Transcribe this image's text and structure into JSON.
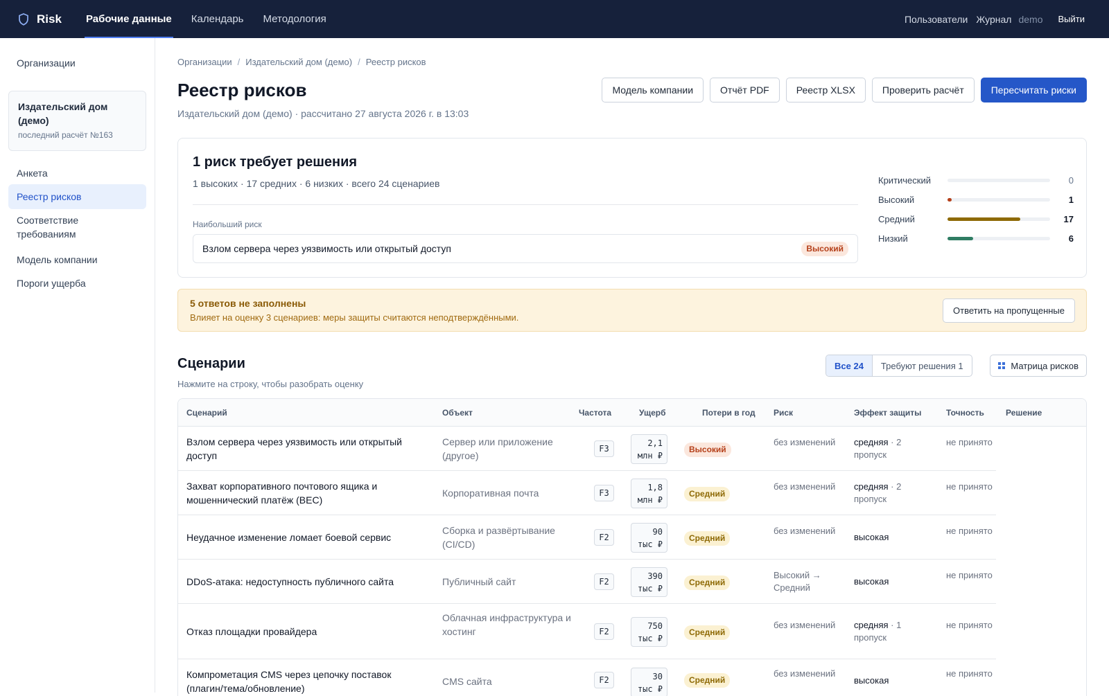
{
  "app": {
    "name": "Risk"
  },
  "nav": [
    {
      "label": "Рабочие данные",
      "active": true
    },
    {
      "label": "Календарь",
      "active": false
    },
    {
      "label": "Методология",
      "active": false
    }
  ],
  "topbar": {
    "users": "Пользователи",
    "journal": "Журнал",
    "user": "demo",
    "logout": "Выйти"
  },
  "sidebar": {
    "orgs_link": "Организации",
    "org_card": {
      "name": "Издательский дом (демо)",
      "sub": "последний расчёт №163"
    },
    "items": [
      {
        "label": "Анкета",
        "active": false
      },
      {
        "label": "Реестр рисков",
        "active": true
      },
      {
        "label": "Соответствие требованиям",
        "active": false
      },
      {
        "label": "Модель компании",
        "active": false
      },
      {
        "label": "Пороги ущерба",
        "active": false
      }
    ]
  },
  "breadcrumb": [
    "Организации",
    "Издательский дом (демо)",
    "Реестр рисков"
  ],
  "page": {
    "title": "Реестр рисков",
    "subtitle": "Издательский дом (демо) · рассчитано 27 августа 2026 г. в 13:03"
  },
  "actions": {
    "model": "Модель компании",
    "pdf": "Отчёт PDF",
    "xlsx": "Реестр XLSX",
    "check": "Проверить расчёт",
    "recalc": "Пересчитать риски"
  },
  "summary": {
    "title": "1 риск требует решения",
    "subtitle": "1 высоких · 17 средних · 6 низких · всего 24 сценариев",
    "top_label": "Наибольший риск",
    "top_risk": "Взлом сервера через уязвимость или открытый доступ",
    "top_level": "Высокий",
    "distribution": [
      {
        "label": "Критический",
        "count": 0,
        "fraction": 0.0,
        "color": "#b5401a"
      },
      {
        "label": "Высокий",
        "count": 1,
        "fraction": 0.04,
        "color": "#b5401a"
      },
      {
        "label": "Средний",
        "count": 17,
        "fraction": 0.71,
        "color": "#8e6a06"
      },
      {
        "label": "Низкий",
        "count": 6,
        "fraction": 0.25,
        "color": "#2f7d63"
      }
    ]
  },
  "alert": {
    "title": "5 ответов не заполнены",
    "text": "Влияет на оценку 3 сценариев: меры защиты считаются неподтверждёнными.",
    "button": "Ответить на пропущенные"
  },
  "scenarios": {
    "title": "Сценарии",
    "subtitle": "Нажмите на строку, чтобы разобрать оценку",
    "filter_all": "Все 24",
    "filter_pending": "Требуют решения 1",
    "matrix_button": "Матрица рисков",
    "columns": {
      "scenario": "Сценарий",
      "object": "Объект",
      "freq": "Частота",
      "damage": "Ущерб",
      "loss": "Потери в год",
      "risk": "Риск",
      "effect": "Эффект защиты",
      "accuracy": "Точность",
      "decision": "Решение"
    },
    "rows": [
      {
        "scenario": "Взлом сервера через уязвимость или открытый доступ",
        "object": "Сервер или приложение (другое)",
        "freq": "F3",
        "dmg1": "2,1",
        "dmg2": "млн ₽",
        "loss": "Высокий",
        "level": "high",
        "risk": "без изменений",
        "effect": "средняя",
        "effect_extra": "· 2 пропуск",
        "accuracy": "не принято"
      },
      {
        "scenario": "Захват корпоративного почтового ящика и мошеннический платёж (BEC)",
        "object": "Корпоративная почта",
        "freq": "F3",
        "dmg1": "1,8",
        "dmg2": "млн ₽",
        "loss": "Средний",
        "level": "med",
        "risk": "без изменений",
        "effect": "средняя",
        "effect_extra": "· 2 пропуск",
        "accuracy": "не принято"
      },
      {
        "scenario": "Неудачное изменение ломает боевой сервис",
        "object": "Сборка и развёртывание (CI/CD)",
        "freq": "F2",
        "dmg1": "90",
        "dmg2": "тыс ₽",
        "loss": "Средний",
        "level": "med",
        "risk": "без изменений",
        "effect": "высокая",
        "effect_extra": "",
        "accuracy": "не принято"
      },
      {
        "scenario": "DDoS-атака: недоступность публичного сайта",
        "object": "Публичный сайт",
        "freq": "F2",
        "dmg1": "390",
        "dmg2": "тыс ₽",
        "loss": "Средний",
        "level": "med",
        "risk": "Высокий → Средний",
        "effect": "высокая",
        "effect_extra": "",
        "accuracy": "не принято"
      },
      {
        "scenario": "Отказ площадки провайдера",
        "object": "Облачная инфраструктура и хостинг",
        "freq": "F2",
        "dmg1": "750",
        "dmg2": "тыс ₽",
        "loss": "Средний",
        "level": "med",
        "risk": "без изменений",
        "effect": "средняя",
        "effect_extra": "· 1 пропуск",
        "accuracy": "не принято"
      },
      {
        "scenario": "Компрометация CMS через цепочку поставок (плагин/тема/обновление)",
        "object": "CMS сайта",
        "freq": "F2",
        "dmg1": "30",
        "dmg2": "тыс ₽",
        "loss": "Средний",
        "level": "med",
        "risk": "без изменений",
        "effect": "высокая",
        "effect_extra": "",
        "accuracy": "не принято"
      }
    ]
  }
}
